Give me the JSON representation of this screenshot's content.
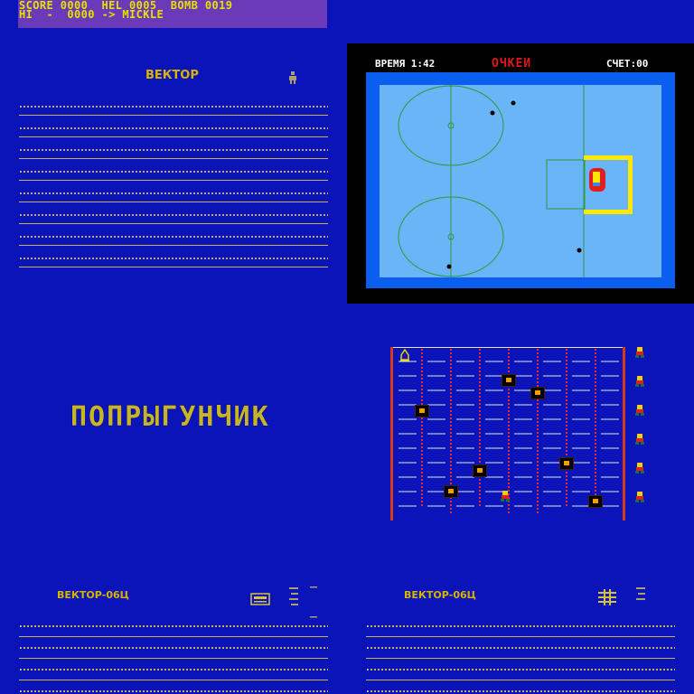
{
  "status": {
    "line1": "SCORE 0000  HEL 0005  BOMB 0019",
    "line2": "HI  -  0000 -> MICKLE"
  },
  "vector_title": "ВЕКТОР",
  "hockey": {
    "time_label": "ВРЕМЯ 1:42",
    "title": "ОЧКЕИ",
    "score_label": "СЧЕТ:00"
  },
  "jumper_title": "ПОПРЫГУНЧИК",
  "vector06c_left": "ВЕКТОР-06Ц",
  "vector06c_right": "ВЕКТОР-06Ц",
  "colors": {
    "background": "#0a14b8",
    "status_bg": "#6a3ab8",
    "text_yellow": "#e8e000",
    "rink": "#6ab4f8",
    "rink_border": "#0a5ef0",
    "goal": "#ffe800"
  },
  "icons": {
    "vector_icon": "figure-icon",
    "cassette": "cassette-icon",
    "ladder": "ladder-icon"
  }
}
